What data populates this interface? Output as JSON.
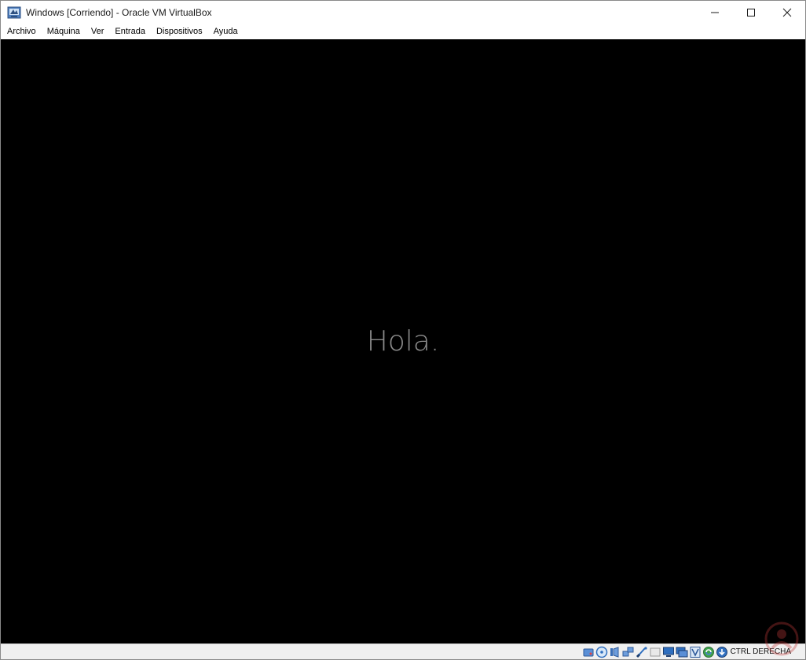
{
  "window": {
    "title": "Windows [Corriendo] - Oracle VM VirtualBox",
    "app_icon": "virtualbox-vm-icon",
    "controls": {
      "minimize_icon": "minimize-icon",
      "maximize_icon": "maximize-icon",
      "close_icon": "close-icon"
    }
  },
  "menu": {
    "items": [
      {
        "label": "Archivo"
      },
      {
        "label": "Máquina"
      },
      {
        "label": "Ver"
      },
      {
        "label": "Entrada"
      },
      {
        "label": "Dispositivos"
      },
      {
        "label": "Ayuda"
      }
    ]
  },
  "vm_screen": {
    "greeting": "Hola.",
    "background": "#000000",
    "text_color": "#8c8c8c"
  },
  "statusbar": {
    "icons": [
      "hard-disk-icon",
      "optical-drive-icon",
      "audio-icon",
      "network-icon",
      "usb-icon",
      "shared-folders-icon",
      "display-icon",
      "recording-icon",
      "guest-additions-icon",
      "mouse-integration-icon",
      "keyboard-capture-icon"
    ],
    "host_key": "CTRL DERECHA"
  },
  "watermark_icon": "solvetic-logo-icon"
}
